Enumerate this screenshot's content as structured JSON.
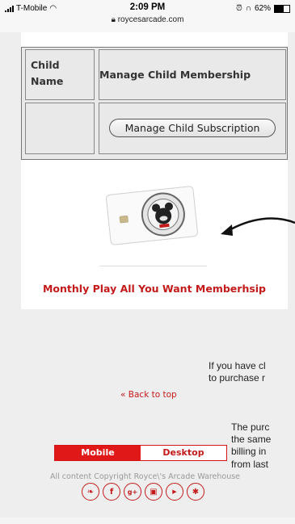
{
  "status_bar": {
    "carrier": "T-Mobile",
    "time": "2:09 PM",
    "url": "roycesarcade.com",
    "battery": "62%"
  },
  "table": {
    "col1_header": "Child Name",
    "col2_header": "Manage Child Membership",
    "manage_button": "Manage Child Subscription"
  },
  "membership": {
    "title": "Monthly Play All You Want Memberhsip"
  },
  "side_text": {
    "line1": "If you have cl",
    "line2": "to purchase r",
    "line3": "The purc",
    "line4": "the same",
    "line5": "billing in",
    "line6": "from last"
  },
  "footer": {
    "back_to_top": "Back to top",
    "mobile_label": "Mobile",
    "desktop_label": "Desktop",
    "copyright": "All content Copyright Royce\\'s Arcade Warehouse",
    "socials": [
      "twitter-icon",
      "facebook-icon",
      "google-plus-icon",
      "instagram-icon",
      "youtube-icon",
      "yelp-icon"
    ]
  },
  "colors": {
    "accent": "#c41a1a",
    "toggle_active": "#e01818"
  }
}
